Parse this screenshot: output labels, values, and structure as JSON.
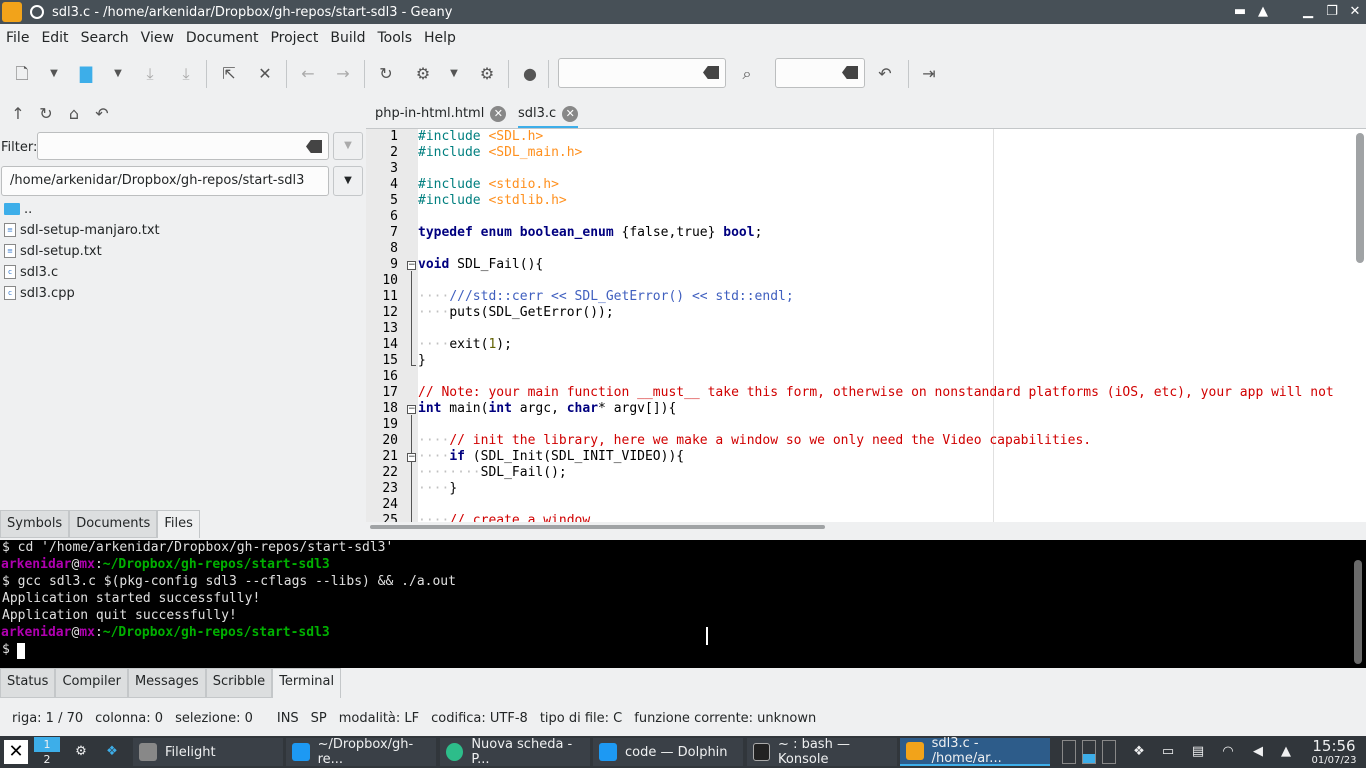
{
  "window": {
    "title": "sdl3.c - /home/arkenidar/Dropbox/gh-repos/start-sdl3 - Geany"
  },
  "menu": [
    "File",
    "Edit",
    "Search",
    "View",
    "Document",
    "Project",
    "Build",
    "Tools",
    "Help"
  ],
  "sidebar": {
    "filter_label": "Filter:",
    "path": "/home/arkenidar/Dropbox/gh-repos/start-sdl3",
    "parent": "..",
    "files": [
      {
        "name": "sdl-setup-manjaro.txt",
        "icon": "text-file-icon"
      },
      {
        "name": "sdl-setup.txt",
        "icon": "text-file-icon"
      },
      {
        "name": "sdl3.c",
        "icon": "c-file-icon"
      },
      {
        "name": "sdl3.cpp",
        "icon": "cpp-file-icon"
      }
    ],
    "tabs": [
      "Symbols",
      "Documents",
      "Files"
    ],
    "active_tab": "Files"
  },
  "doc_tabs": [
    {
      "label": "php-in-html.html",
      "active": false
    },
    {
      "label": "sdl3.c",
      "active": true
    }
  ],
  "editor": {
    "line_numbers": [
      "1",
      "2",
      "3",
      "4",
      "5",
      "6",
      "7",
      "8",
      "9",
      "10",
      "11",
      "12",
      "13",
      "14",
      "15",
      "16",
      "17",
      "18",
      "19",
      "20",
      "21",
      "22",
      "23",
      "24",
      "25"
    ],
    "lines": {
      "l1a": "#include ",
      "l1b": "<SDL.h>",
      "l2a": "#include ",
      "l2b": "<SDL_main.h>",
      "l4a": "#include ",
      "l4b": "<stdio.h>",
      "l5a": "#include ",
      "l5b": "<stdlib.h>",
      "l7a": "typedef",
      "l7b": " ",
      "l7c": "enum",
      "l7d": " ",
      "l7e": "boolean_enum",
      "l7f": " {",
      "l7g": "false",
      "l7h": ",",
      "l7i": "true",
      "l7j": "} ",
      "l7k": "bool",
      "l7l": ";",
      "l9a": "void",
      "l9b": " SDL_Fail(){",
      "l11a": "····",
      "l11b": "///std::cerr << SDL_GetError() << std::endl;",
      "l12a": "····",
      "l12b": "puts(SDL_GetError());",
      "l14a": "····",
      "l14b": "exit(",
      "l14c": "1",
      "l14d": ");",
      "l15a": "}",
      "l17a": "// Note: your main function __must__ take this form, otherwise on nonstandard platforms (iOS, etc), your app will not",
      "l18a": "int",
      "l18b": " main(",
      "l18c": "int",
      "l18d": " argc, ",
      "l18e": "char",
      "l18f": "* argv[]){",
      "l20a": "····",
      "l20b": "// init the library, here we make a window so we only need the Video capabilities.",
      "l21a": "····",
      "l21b": "if",
      "l21c": " (SDL_Init(SDL_INIT_VIDEO)){",
      "l22a": "········",
      "l22b": "SDL_Fail();",
      "l23a": "····",
      "l23b": "}",
      "l25a": "····",
      "l25b": "// create a window"
    }
  },
  "terminal": {
    "l1": "$ cd '/home/arkenidar/Dropbox/gh-repos/start-sdl3'",
    "user": "arkenidar",
    "at": "@",
    "host": "mx",
    "sep": ":",
    "path": "~/Dropbox/gh-repos/start-sdl3",
    "l3": "$ gcc sdl3.c $(pkg-config sdl3 --cflags --libs) && ./a.out",
    "l4": "Application started successfully!",
    "l5": "Application quit successfully!",
    "prompt": "$ "
  },
  "msg_tabs": [
    "Status",
    "Compiler",
    "Messages",
    "Scribble",
    "Terminal"
  ],
  "active_msg_tab": "Terminal",
  "status": {
    "line": "riga: 1 / 70",
    "col": "colonna: 0",
    "sel": "selezione: 0",
    "ins": "INS",
    "sp": "SP",
    "mode": "modalità: LF",
    "enc": "codifica: UTF-8",
    "ftype": "tipo di file: C",
    "func": "funzione corrente: unknown"
  },
  "taskbar": {
    "desktops": [
      "1",
      "2"
    ],
    "tasks": [
      {
        "label": "Filelight",
        "icon": "filelight-icon"
      },
      {
        "label": "~/Dropbox/gh-re...",
        "icon": "terminal-icon"
      },
      {
        "label": "Nuova scheda - P...",
        "icon": "edge-browser-icon"
      },
      {
        "label": "code — Dolphin",
        "icon": "dolphin-icon"
      },
      {
        "label": "~ : bash — Konsole",
        "icon": "konsole-icon"
      },
      {
        "label": "sdl3.c - /home/ar...",
        "icon": "geany-icon"
      }
    ],
    "clock_time": "15:56",
    "clock_date": "01/07/23"
  },
  "colors": {
    "accent": "#3daee9",
    "titlebar": "#475057",
    "taskbar": "#31363b"
  }
}
